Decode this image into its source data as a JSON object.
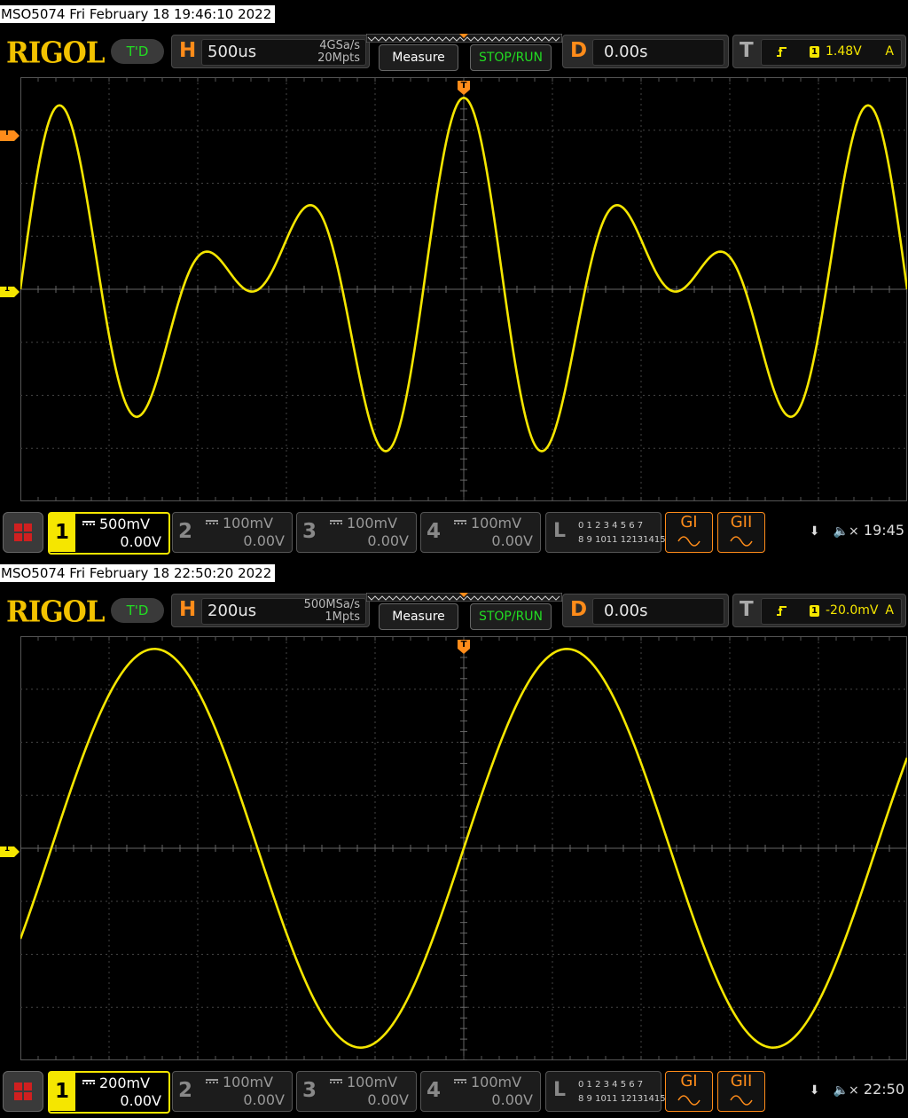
{
  "colors": {
    "trace": "#f5e600",
    "accent": "#ff8c1a",
    "green": "#22dd22",
    "grid": "#555555"
  },
  "screens": [
    {
      "caption": "MSO5074  Fri February 18 19:46:10 2022",
      "logo": "RIGOL",
      "mode": "T'D",
      "horizontal": {
        "letter": "H",
        "timebase": "500us",
        "sample_rate": "4GSa/s",
        "memory_depth": "20Mpts"
      },
      "measure_label": "Measure",
      "stoprun_label": "STOP/RUN",
      "delay": {
        "letter": "D",
        "value": "0.00s"
      },
      "trigger": {
        "letter": "T",
        "source": "1",
        "level": "1.48V",
        "mode": "A",
        "edge_icon": "rising-edge-icon"
      },
      "trigger_marker": "T",
      "channel_marker": "1",
      "channels": [
        {
          "num": "1",
          "scale": "500mV",
          "offset": "0.00V",
          "active": true
        },
        {
          "num": "2",
          "scale": "100mV",
          "offset": "0.00V",
          "active": false
        },
        {
          "num": "3",
          "scale": "100mV",
          "offset": "0.00V",
          "active": false
        },
        {
          "num": "4",
          "scale": "100mV",
          "offset": "0.00V",
          "active": false
        }
      ],
      "logic": {
        "letter": "L",
        "row1": "0 1 2 3  4 5 6 7",
        "row2": "8 9 1011 12131415"
      },
      "gen1": "GI",
      "gen2": "GII",
      "time": "19:45",
      "waveform": {
        "type": "two-tone",
        "components": [
          {
            "cycles": 6.5,
            "amp": 0.6
          },
          {
            "cycles": 4.5,
            "amp": 0.62
          }
        ],
        "phase_note": "sum of two sines"
      }
    },
    {
      "caption": "MSO5074  Fri February 18 22:50:20 2022",
      "logo": "RIGOL",
      "mode": "T'D",
      "horizontal": {
        "letter": "H",
        "timebase": "200us",
        "sample_rate": "500MSa/s",
        "memory_depth": "1Mpts"
      },
      "measure_label": "Measure",
      "stoprun_label": "STOP/RUN",
      "delay": {
        "letter": "D",
        "value": "0.00s"
      },
      "trigger": {
        "letter": "T",
        "source": "1",
        "level": "-20.0mV",
        "mode": "A",
        "edge_icon": "rising-edge-icon"
      },
      "trigger_marker": "T",
      "channel_marker": "1",
      "channels": [
        {
          "num": "1",
          "scale": "200mV",
          "offset": "0.00V",
          "active": true
        },
        {
          "num": "2",
          "scale": "100mV",
          "offset": "0.00V",
          "active": false
        },
        {
          "num": "3",
          "scale": "100mV",
          "offset": "0.00V",
          "active": false
        },
        {
          "num": "4",
          "scale": "100mV",
          "offset": "0.00V",
          "active": false
        }
      ],
      "logic": {
        "letter": "L",
        "row1": "0 1 2 3  4 5 6 7",
        "row2": "8 9 1011 12131415"
      },
      "gen1": "GI",
      "gen2": "GII",
      "time": "22:50",
      "waveform": {
        "type": "sine",
        "cycles": 2.15,
        "amp": 0.94
      }
    }
  ]
}
